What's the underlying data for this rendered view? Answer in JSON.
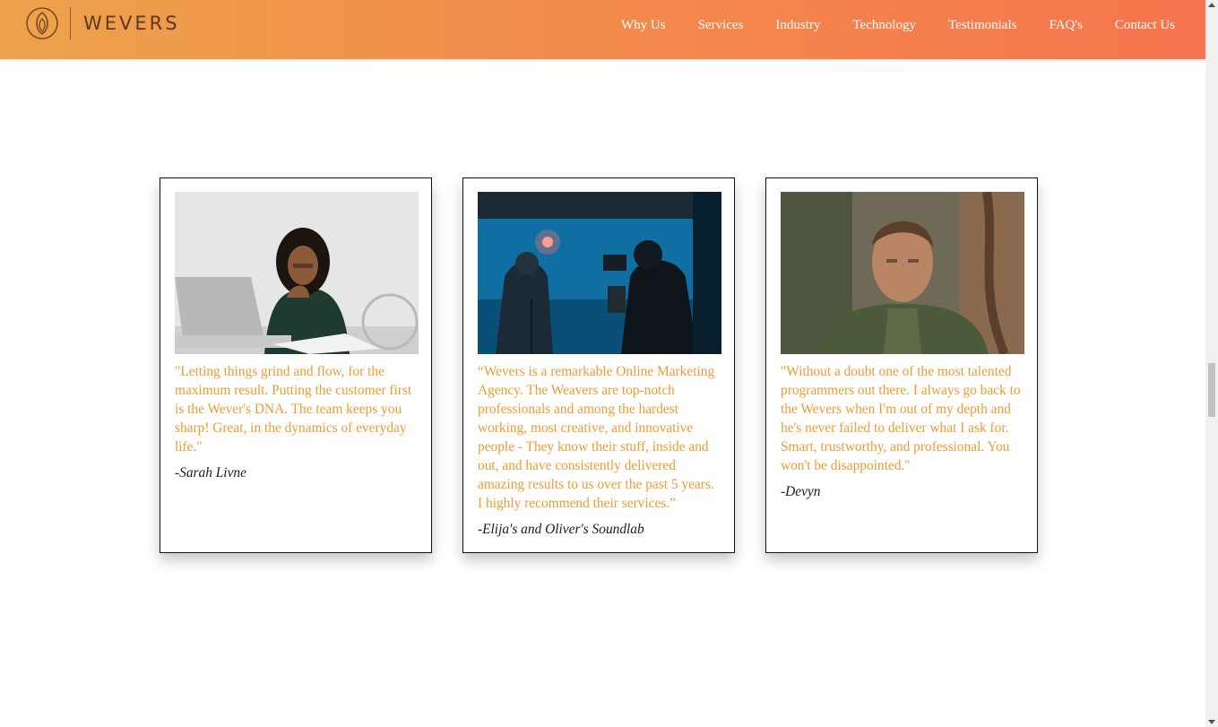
{
  "brand": {
    "name": "WEVERS",
    "logo_icon": "lotus-icon"
  },
  "nav": {
    "items": [
      "Why Us",
      "Services",
      "Industry",
      "Technology",
      "Testimonials",
      "FAQ's",
      "Contact Us"
    ]
  },
  "testimonials": [
    {
      "quote": "\"Letting things grind and flow, for the maximum result. Putting the customer first is the Wever's DNA. The team keeps you sharp! Great, in the dynamics of everyday life.\"",
      "author": "-Sarah Livne",
      "image": "woman-with-laptop-photo"
    },
    {
      "quote": "“Wevers is a remarkable Online Marketing Agency. The Weavers are top-notch professionals and among the hardest working, most creative, and innovative people - They know their stuff, inside and out, and have consistently delivered amazing results to us over the past 5 years. I highly recommend their services.”",
      "author": "-Elija's and Oliver's Soundlab",
      "image": "film-studio-photo"
    },
    {
      "quote": "\"Without a doubt one of the most talented programmers out there. I always go back to the Wevers when I'm out of my depth and he's never failed to deliver what I ask for. Smart, trustworthy, and professional. You won't be disappointed.\"",
      "author": "-Devyn",
      "image": "man-portrait-photo"
    }
  ],
  "colors": {
    "header_start": "#eda24b",
    "header_end": "#f6744e",
    "quote": "#ef9b33"
  }
}
